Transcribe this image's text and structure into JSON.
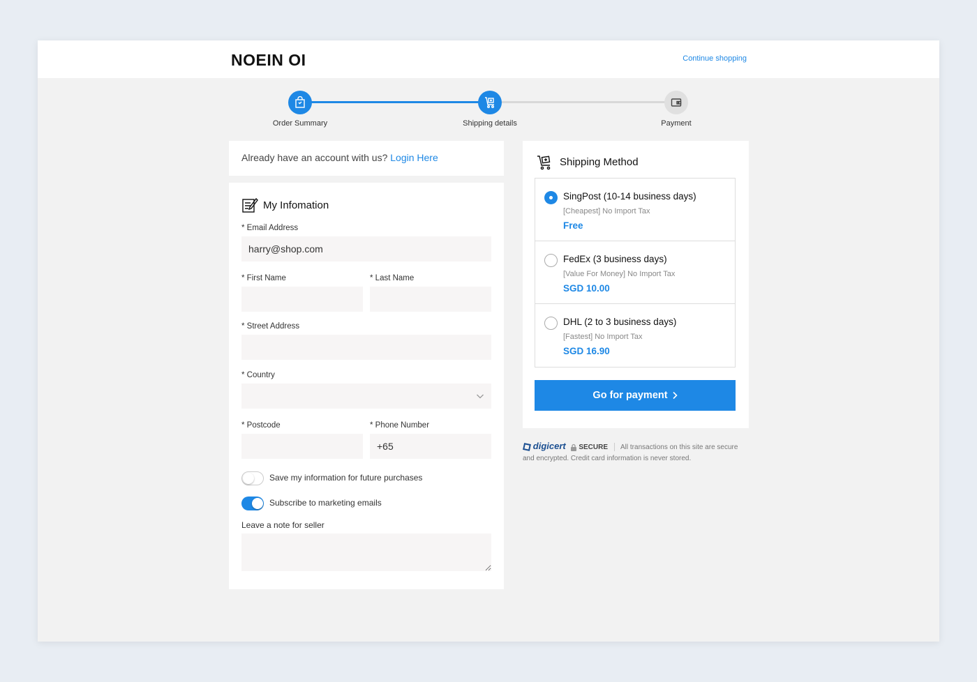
{
  "header": {
    "brand": "NOEIN OI",
    "continue_label": "Continue shopping"
  },
  "stepper": {
    "steps": [
      {
        "label": "Order Summary",
        "state": "complete",
        "icon": "shopping-bag-icon"
      },
      {
        "label": "Shipping details",
        "state": "active",
        "icon": "shipping-cart-icon"
      },
      {
        "label": "Payment",
        "state": "pending",
        "icon": "wallet-icon"
      }
    ]
  },
  "login": {
    "prompt": "Already have an account with us?",
    "link": "Login Here"
  },
  "info": {
    "title": "My Infomation",
    "email_label": "* Email Address",
    "email_value": "harry@shop.com",
    "first_name_label": "* First Name",
    "last_name_label": "* Last Name",
    "street_label": "* Street Address",
    "country_label": "* Country",
    "postcode_label": "* Postcode",
    "phone_label": "* Phone Number",
    "phone_value": "+65",
    "save_label": "Save my information for future purchases",
    "save_on": false,
    "subscribe_label": "Subscribe to marketing emails",
    "subscribe_on": true,
    "note_label": "Leave a note for seller"
  },
  "shipping": {
    "title": "Shipping Method",
    "methods": [
      {
        "name": "SingPost (10-14 business days)",
        "desc": "[Cheapest] No Import Tax",
        "price": "Free",
        "selected": true
      },
      {
        "name": "FedEx (3 business days)",
        "desc": "[Value For Money] No Import Tax",
        "price": "SGD 10.00",
        "selected": false
      },
      {
        "name": "DHL (2 to 3 business days)",
        "desc": "[Fastest] No Import Tax",
        "price": "SGD 16.90",
        "selected": false
      }
    ],
    "pay_button": "Go for payment"
  },
  "secure": {
    "logo": "digicert",
    "badge": "SECURE",
    "text": "All transactions on this site are secure and encrypted. Credit card information is never stored."
  },
  "colors": {
    "accent": "#1e88e5",
    "background": "#e8edf3",
    "panel": "#f2f2f2"
  }
}
